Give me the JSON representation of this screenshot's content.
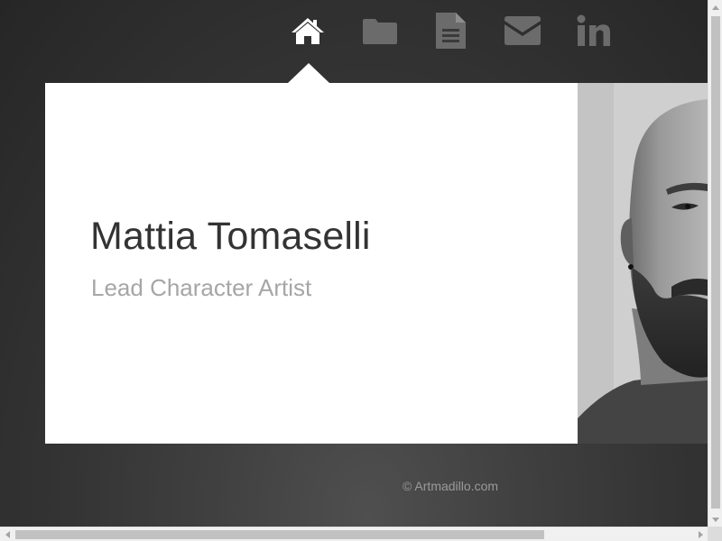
{
  "nav": {
    "items": [
      {
        "icon": "home-icon",
        "active": true
      },
      {
        "icon": "folder-icon",
        "active": false
      },
      {
        "icon": "document-icon",
        "active": false
      },
      {
        "icon": "envelope-icon",
        "active": false
      },
      {
        "icon": "linkedin-icon",
        "active": false
      }
    ],
    "active_color": "#ffffff",
    "inactive_color": "#6b6b6b"
  },
  "profile": {
    "name": "Mattia Tomaselli",
    "role": "Lead Character Artist",
    "photo": "portrait-photo"
  },
  "footer": {
    "copyright": "© Artmadillo.com"
  },
  "colors": {
    "background": "#333333",
    "card": "#ffffff",
    "name_text": "#333333",
    "role_text": "#a6a6a6"
  }
}
